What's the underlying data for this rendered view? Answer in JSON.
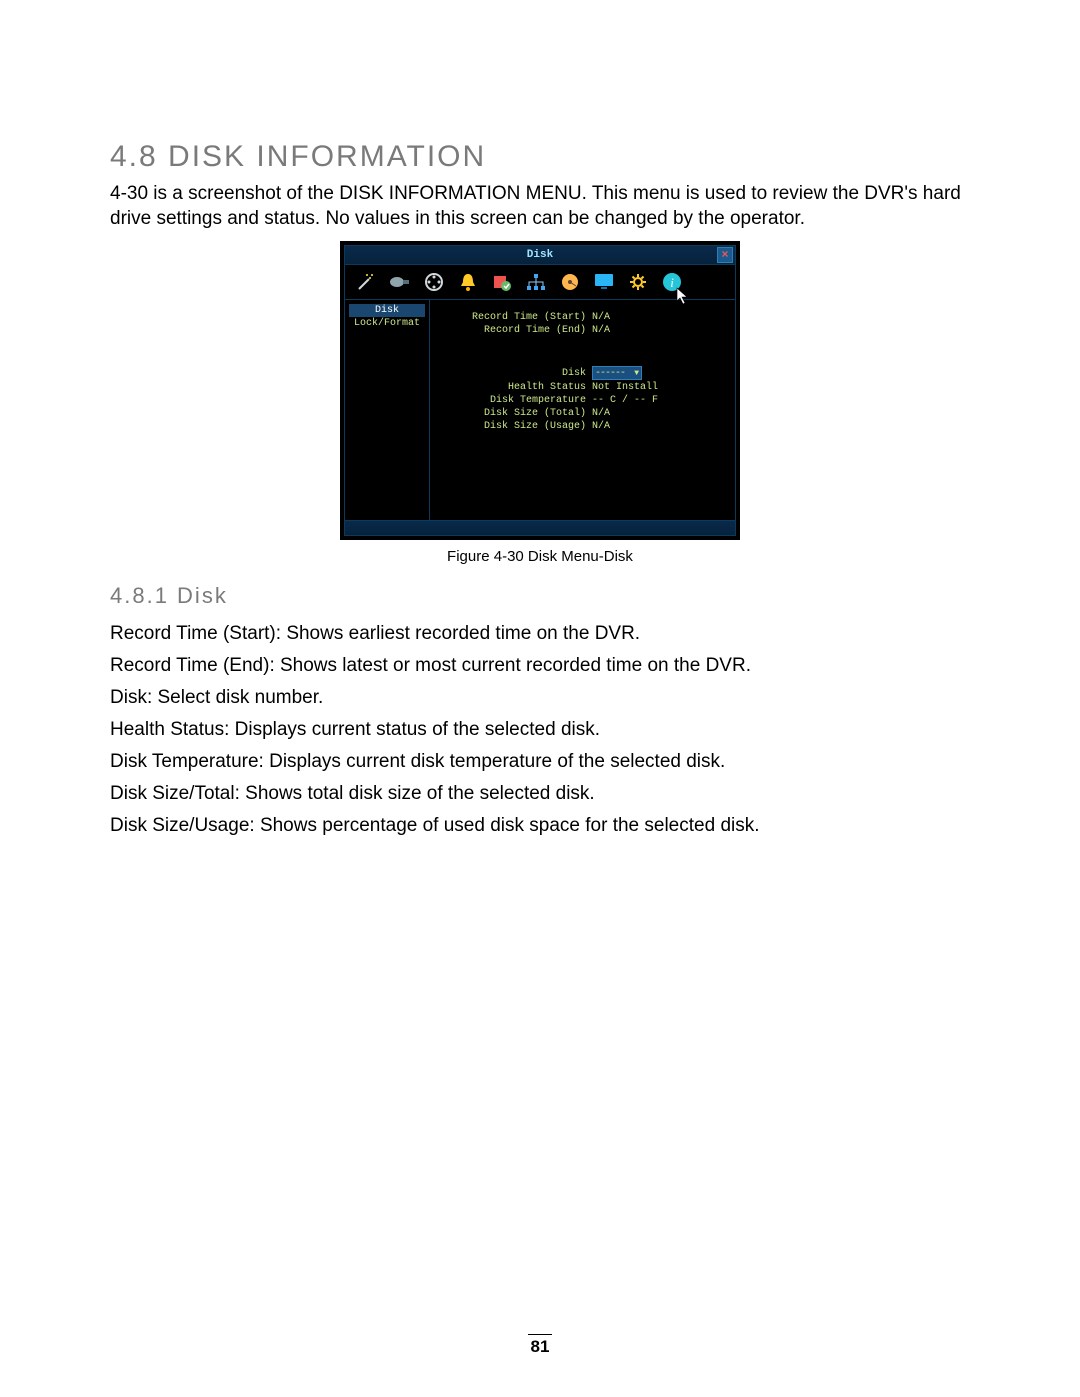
{
  "heading": "4.8 DISK INFORMATION",
  "intro": "4-30 is a screenshot of the DISK INFORMATION MENU. This menu is used to review the DVR's hard drive settings and status. No values in this screen can be changed by the operator.",
  "figure_caption": "Figure 4-30 Disk Menu-Disk",
  "sub_heading": "4.8.1 Disk",
  "lines": {
    "l1": "Record Time (Start): Shows earliest recorded time on the DVR.",
    "l2": "Record Time (End): Shows latest or most current recorded time on the DVR.",
    "l3": "Disk: Select disk number.",
    "l4": "Health Status: Displays current status of the selected disk.",
    "l5": "Disk Temperature: Displays current disk temperature of the selected disk.",
    "l6": "Disk Size/Total: Shows total disk size of the selected disk.",
    "l7": "Disk Size/Usage: Shows percentage of used disk space for the selected disk."
  },
  "page_number": "81",
  "menu": {
    "title": "Disk",
    "close_label": "×",
    "sidebar": {
      "item1": "Disk",
      "item2": "Lock/Format"
    },
    "rows": {
      "record_start_label": "Record Time (Start)",
      "record_start_value": "N/A",
      "record_end_label": "Record Time (End)",
      "record_end_value": "N/A",
      "disk_label": "Disk",
      "disk_value": "------",
      "health_label": "Health Status",
      "health_value": "Not Install",
      "temp_label": "Disk Temperature",
      "temp_value": "-- C / -- F",
      "size_total_label": "Disk Size (Total)",
      "size_total_value": "N/A",
      "size_usage_label": "Disk Size (Usage)",
      "size_usage_value": "N/A"
    }
  }
}
